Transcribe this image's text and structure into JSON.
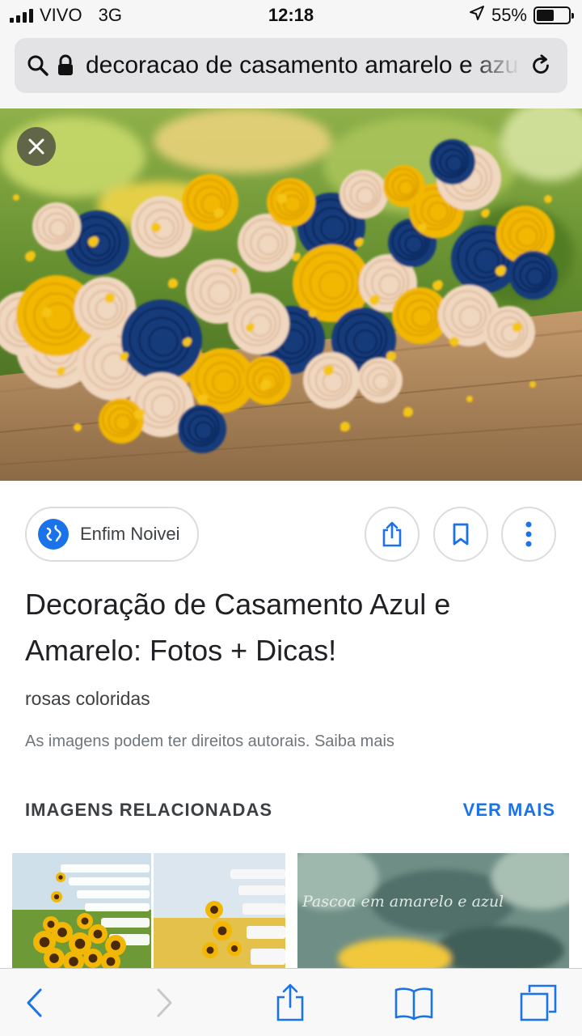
{
  "status_bar": {
    "carrier": "VIVO",
    "network": "3G",
    "time": "12:18",
    "battery_percent": "55%",
    "battery_level": 0.55
  },
  "address_bar": {
    "url_text": "decoracao de casamento amarelo e azul",
    "icons": [
      "search-icon",
      "lock-icon",
      "reload-icon"
    ]
  },
  "hero": {
    "close_icon": "close-icon"
  },
  "result": {
    "source_name": "Enfim Noivei",
    "source_icon": "globe-icon",
    "actions": [
      "share-icon",
      "bookmark-icon",
      "more-vert-icon"
    ],
    "title": "Decoração de Casamento Azul e Amarelo: Fotos + Dicas!",
    "subtitle": "rosas coloridas",
    "copyright_notice": "As imagens podem ter direitos autorais. Saiba mais"
  },
  "related": {
    "header": "IMAGENS RELACIONADAS",
    "see_more": "VER MAIS",
    "thumb_3_caption": "Pascoa em amarelo e azul"
  },
  "toolbar": {
    "icons": [
      "back-icon",
      "forward-icon",
      "share-icon",
      "bookmarks-icon",
      "tabs-icon"
    ]
  },
  "colors": {
    "accent": "#1a73e8",
    "flower_blue": "#123a7a",
    "flower_yellow": "#f2b705",
    "flower_peach": "#f0d7bf"
  }
}
